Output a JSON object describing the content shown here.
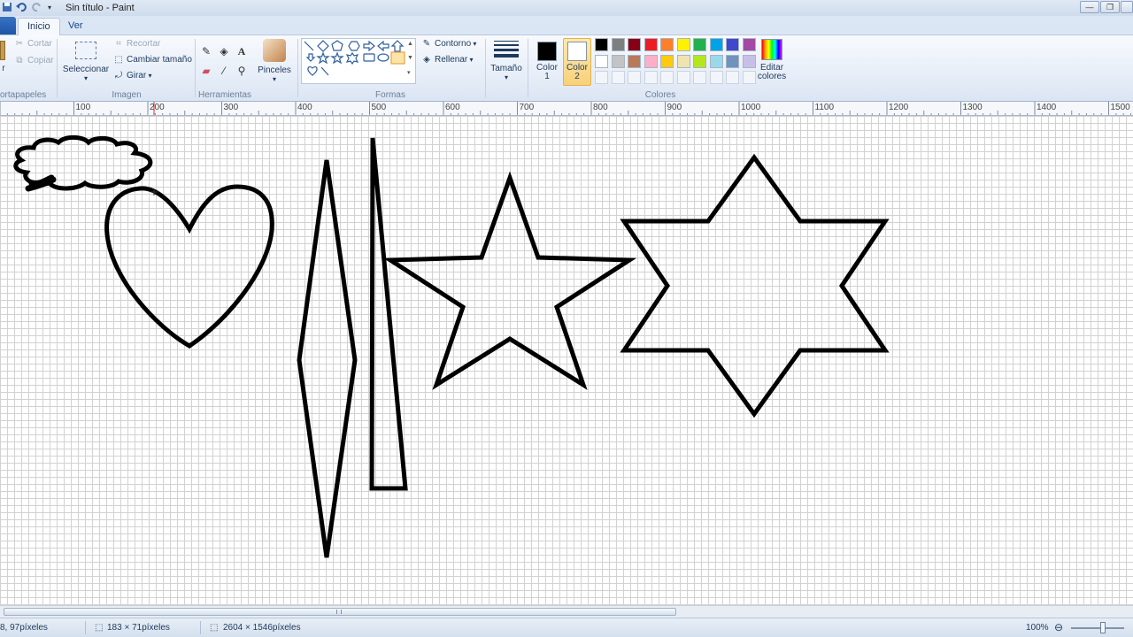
{
  "window": {
    "title": "Sin título - Paint"
  },
  "tabs": [
    {
      "label": "Inicio"
    },
    {
      "label": "Ver"
    }
  ],
  "clipboard": {
    "cut_label": "Cortar",
    "copy_label": "Copiar",
    "group_label": "ortapapeles",
    "paste_label": "r"
  },
  "image": {
    "select_label": "Seleccionar",
    "crop_label": "Recortar",
    "resize_label": "Cambiar tamaño",
    "rotate_label": "Girar",
    "group_label": "Imagen"
  },
  "tools": {
    "group_label": "Herramientas",
    "brushes_label": "Pinceles"
  },
  "shapes": {
    "outline_label": "Contorno",
    "fill_label": "Rellenar",
    "group_label": "Formas"
  },
  "size": {
    "label": "Tamaño"
  },
  "colors": {
    "color1_label": "Color 1",
    "color2_label": "Color 2",
    "color1": "#000000",
    "color2": "#ffffff",
    "edit_label": "Editar colores",
    "group_label": "Colores",
    "palette_row1": [
      "#000000",
      "#7f7f7f",
      "#880015",
      "#ed1c24",
      "#ff7f27",
      "#fff200",
      "#22b14c",
      "#00a2e8",
      "#3f48cc",
      "#a349a4"
    ],
    "palette_row2": [
      "#ffffff",
      "#c3c3c3",
      "#b97a57",
      "#ffaec9",
      "#ffc90e",
      "#efe4b0",
      "#b5e61d",
      "#99d9ea",
      "#7092be",
      "#c8bfe7"
    ]
  },
  "ruler": {
    "labels": [
      "100",
      "200",
      "300",
      "400",
      "500",
      "600",
      "700",
      "800",
      "900",
      "1000",
      "1100",
      "1200",
      "1300",
      "1400",
      "1500"
    ]
  },
  "status": {
    "cursor_pos": "8, 97píxeles",
    "selection_size": "183 × 71píxeles",
    "image_size": "2604 × 1546píxeles",
    "zoom": "100%"
  }
}
